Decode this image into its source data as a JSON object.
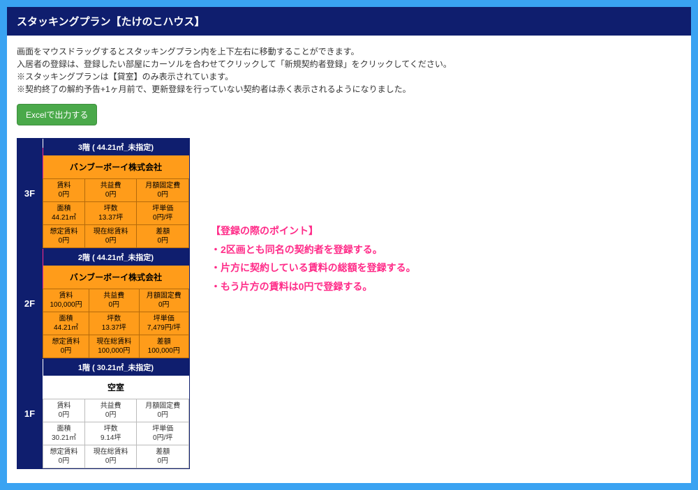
{
  "header": {
    "title": "スタッキングプラン【たけのこハウス】"
  },
  "notes": {
    "l1": "画面をマウスドラッグするとスタッキングプラン内を上下左右に移動することができます。",
    "l2": "入居者の登録は、登録したい部屋にカーソルを合わせてクリックして「新規契約者登録」をクリックしてください。",
    "l3": "※スタッキングプランは【貸室】のみ表示されています。",
    "l4": "※契約終了の解約予告+1ヶ月前で、更新登録を行っていない契約者は赤く表示されるようになりました。"
  },
  "buttons": {
    "excel": "Excelで出力する"
  },
  "callout": {
    "title": "【登録の際のポイント】",
    "p1": "・2区画とも同名の契約者を登録する。",
    "p2": "・片方に契約している賃料の総額を登録する。",
    "p3": "・もう片方の賃料は0円で登録する。"
  },
  "fields": {
    "rent": "賃料",
    "common": "共益費",
    "monthly": "月額固定費",
    "area": "面積",
    "tsubo": "坪数",
    "unitprice": "坪単価",
    "assumed": "想定賃料",
    "current": "現在総賃料",
    "diff": "差額"
  },
  "floors": [
    {
      "label": "3F",
      "unit_header": "3階 ( 44.21㎡_未指定)",
      "tenant": "バンブーボーイ株式会社",
      "style": "orange",
      "rows": [
        {
          "a": "0円",
          "b": "0円",
          "c": "0円"
        },
        {
          "a": "44.21㎡",
          "b": "13.37坪",
          "c": "0円/坪"
        },
        {
          "a": "0円",
          "b": "0円",
          "c": "0円"
        }
      ]
    },
    {
      "label": "2F",
      "unit_header": "2階 ( 44.21㎡_未指定)",
      "tenant": "バンブーボーイ株式会社",
      "style": "orange",
      "rows": [
        {
          "a": "100,000円",
          "b": "0円",
          "c": "0円"
        },
        {
          "a": "44.21㎡",
          "b": "13.37坪",
          "c": "7,479円/坪"
        },
        {
          "a": "0円",
          "b": "100,000円",
          "c": "100,000円"
        }
      ]
    },
    {
      "label": "1F",
      "unit_header": "1階 ( 30.21㎡_未指定)",
      "tenant": "空室",
      "style": "white",
      "rows": [
        {
          "a": "0円",
          "b": "0円",
          "c": "0円"
        },
        {
          "a": "30.21㎡",
          "b": "9.14坪",
          "c": "0円/坪"
        },
        {
          "a": "0円",
          "b": "0円",
          "c": "0円"
        }
      ]
    }
  ]
}
